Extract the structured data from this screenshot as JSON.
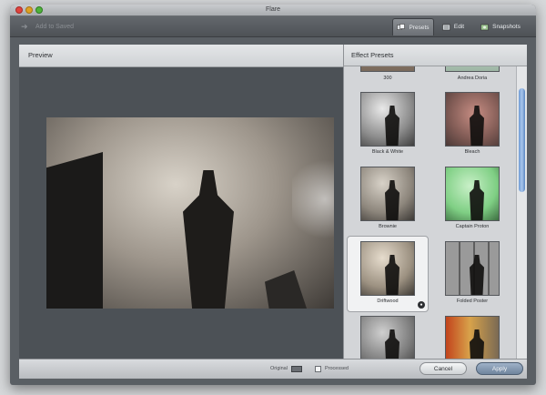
{
  "window": {
    "title": "Flare"
  },
  "toolbar": {
    "add_to_saved": "Add to Saved",
    "tabs": [
      {
        "label": "Presets",
        "active": true,
        "icon": "presets-icon"
      },
      {
        "label": "Edit",
        "active": false,
        "icon": "edit-icon"
      },
      {
        "label": "Snapshots",
        "active": false,
        "icon": "snapshots-icon"
      }
    ]
  },
  "preview": {
    "header": "Preview"
  },
  "presets": {
    "header": "Effect Presets",
    "items": [
      {
        "label": "300"
      },
      {
        "label": "Andrea Doria"
      },
      {
        "label": "Black & White"
      },
      {
        "label": "Bleach"
      },
      {
        "label": "Brownie"
      },
      {
        "label": "Captain Proton"
      },
      {
        "label": "Driftwood",
        "selected": true
      },
      {
        "label": "Folded Poster"
      },
      {
        "label": ""
      },
      {
        "label": ""
      }
    ]
  },
  "bottom": {
    "original_label": "Original",
    "processed_label": "Processed",
    "cancel_label": "Cancel",
    "apply_label": "Apply"
  },
  "colors": {
    "accent_apply": "#7f93ab",
    "scroll_thumb": "#7ea6dc",
    "window_bg": "#5a5f64"
  }
}
